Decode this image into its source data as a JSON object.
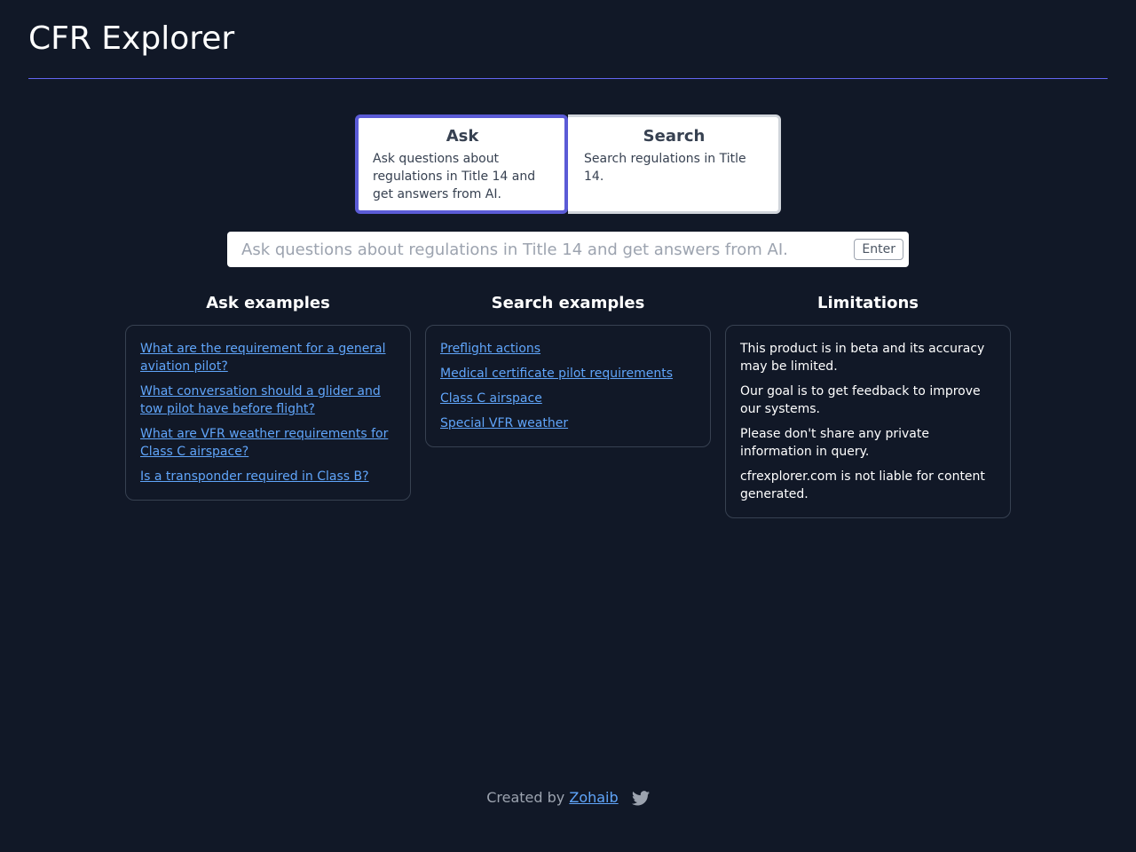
{
  "app": {
    "title": "CFR Explorer"
  },
  "modes": {
    "ask": {
      "title": "Ask",
      "description": "Ask questions about regulations in Title 14 and get answers from AI."
    },
    "search": {
      "title": "Search",
      "description": "Search regulations in Title 14."
    },
    "selected": "ask"
  },
  "query": {
    "placeholder": "Ask questions about regulations in Title 14 and get answers from AI.",
    "value": "",
    "enter_label": "Enter"
  },
  "ask_examples": {
    "heading": "Ask examples",
    "items": [
      "What are the requirement for a general aviation pilot?",
      "What conversation should a glider and tow pilot have before flight?",
      "What are VFR weather requirements for Class C airspace?",
      "Is a transponder required in Class B?"
    ]
  },
  "search_examples": {
    "heading": "Search examples",
    "items": [
      "Preflight actions",
      "Medical certificate pilot requirements",
      "Class C airspace",
      "Special VFR weather"
    ]
  },
  "limitations": {
    "heading": "Limitations",
    "items": [
      "This product is in beta and its accuracy may be limited.",
      "Our goal is to get feedback to improve our systems.",
      "Please don't share any private information in query.",
      "cfrexplorer.com is not liable for content generated."
    ]
  },
  "footer": {
    "prefix": "Created by",
    "author": "Zohaib",
    "icon": "twitter-icon"
  },
  "colors": {
    "background": "#111827",
    "accent": "#5b5bd6",
    "link": "#60a5fa"
  }
}
